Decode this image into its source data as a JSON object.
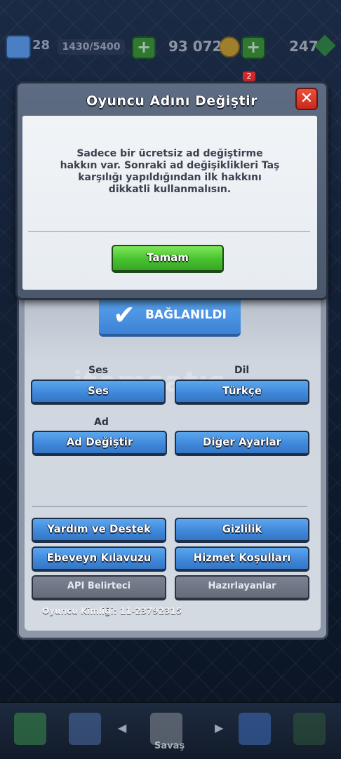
{
  "topbar": {
    "level": "28",
    "xp": "1430/5400",
    "gold": "93 072",
    "gems": "247",
    "notification_count": "2"
  },
  "dialog": {
    "title": "Oyuncu Adını Değiştir",
    "close_symbol": "✕",
    "message": "Sadece bir ücretsiz ad değiştirme hakkın var. Sonraki ad değişiklikleri Taş karşılığı yapıldığından ilk hakkını dikkatli kullanmalısın.",
    "ok_label": "Tamam"
  },
  "settings": {
    "connected_label": "BAĞLANILDI",
    "sound_section": "Ses",
    "language_section": "Dil",
    "name_section": "Ad",
    "sound_button": "Ses",
    "language_button": "Türkçe",
    "name_change_button": "Ad Değiştir",
    "other_settings_button": "Diğer Ayarlar",
    "help_button": "Yardım ve Destek",
    "privacy_button": "Gizlilik",
    "parent_guide_button": "Ebeveyn Kılavuzu",
    "terms_button": "Hizmet Koşulları",
    "api_button": "API Belirteci",
    "credits_button": "Hazırlayanlar",
    "player_id": "Oyuncu Kimliği: 11-23792315"
  },
  "watermark": "itemsatış",
  "nav": {
    "battle_label": "Savaş"
  },
  "colors": {
    "primary_button": "#3e86d8",
    "ok_button": "#46c12e",
    "close_button": "#c72a1c",
    "disabled_button": "#646c7a"
  }
}
